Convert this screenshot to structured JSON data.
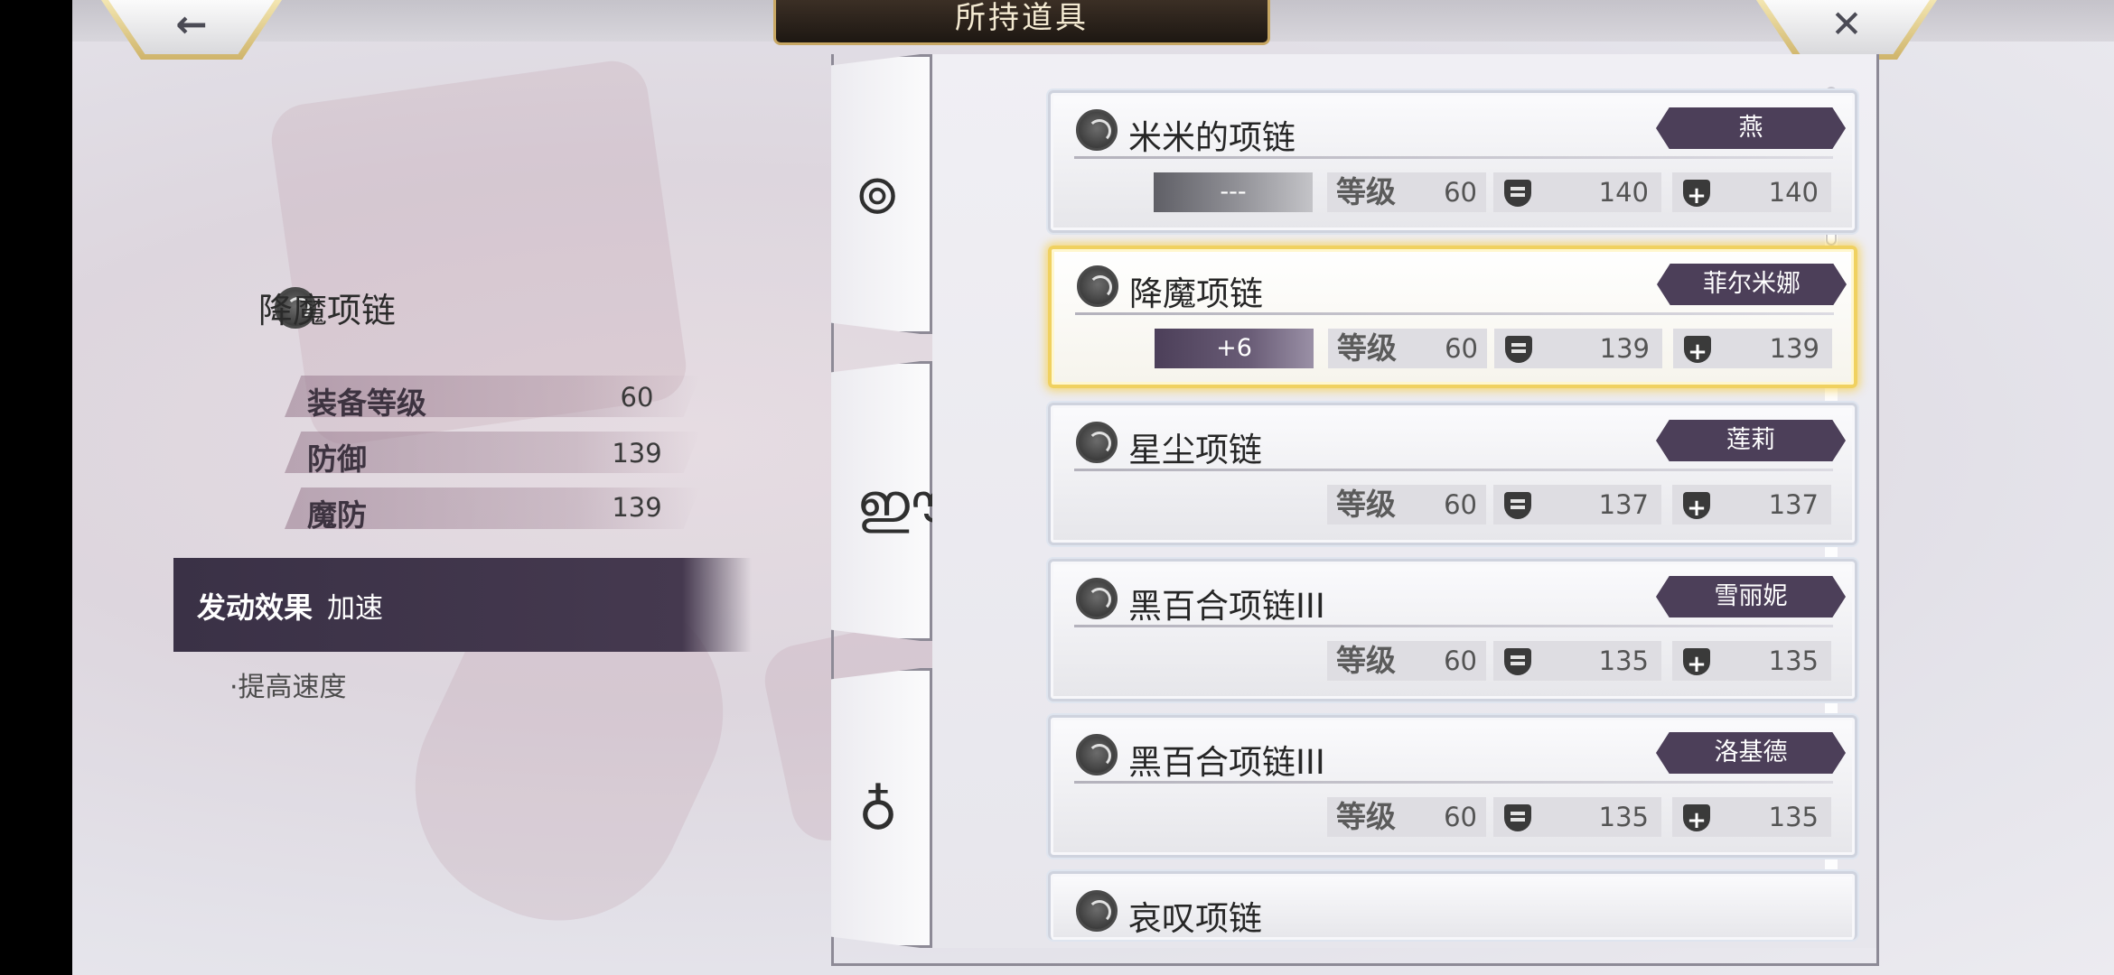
{
  "header": {
    "title": "所持道具",
    "back_icon": "←",
    "close_icon": "✕"
  },
  "detail": {
    "item_name": "降魔项链",
    "stats": [
      {
        "label": "装备等级",
        "value": "60"
      },
      {
        "label": "防御",
        "value": "139"
      },
      {
        "label": "魔防",
        "value": "139"
      }
    ],
    "effect_label": "发动效果",
    "effect_value": "加速",
    "effect_description": "·提高速度"
  },
  "category_tabs": [
    {
      "name": "bracelet-icon",
      "glyph": "⊚"
    },
    {
      "name": "necklace-icon",
      "glyph": "ഈ"
    },
    {
      "name": "ring-icon",
      "glyph": "♁"
    }
  ],
  "level_label": "等级",
  "items": [
    {
      "name": "米米的项链",
      "character": "燕",
      "enhance": "---",
      "level": "60",
      "defense": "140",
      "magic_defense": "140"
    },
    {
      "name": "降魔项链",
      "character": "菲尔米娜",
      "enhance": "+6",
      "level": "60",
      "defense": "139",
      "magic_defense": "139",
      "selected": true
    },
    {
      "name": "星尘项链",
      "character": "莲莉",
      "level": "60",
      "defense": "137",
      "magic_defense": "137"
    },
    {
      "name": "黑百合项链III",
      "character": "雪丽妮",
      "level": "60",
      "defense": "135",
      "magic_defense": "135"
    },
    {
      "name": "黑百合项链III",
      "character": "洛基德",
      "level": "60",
      "defense": "135",
      "magic_defense": "135"
    },
    {
      "name": "哀叹项链"
    }
  ],
  "colors": {
    "accent_dark": "#4c3f59",
    "selected_border": "#f0d160",
    "title_bg": "#2a221b"
  }
}
